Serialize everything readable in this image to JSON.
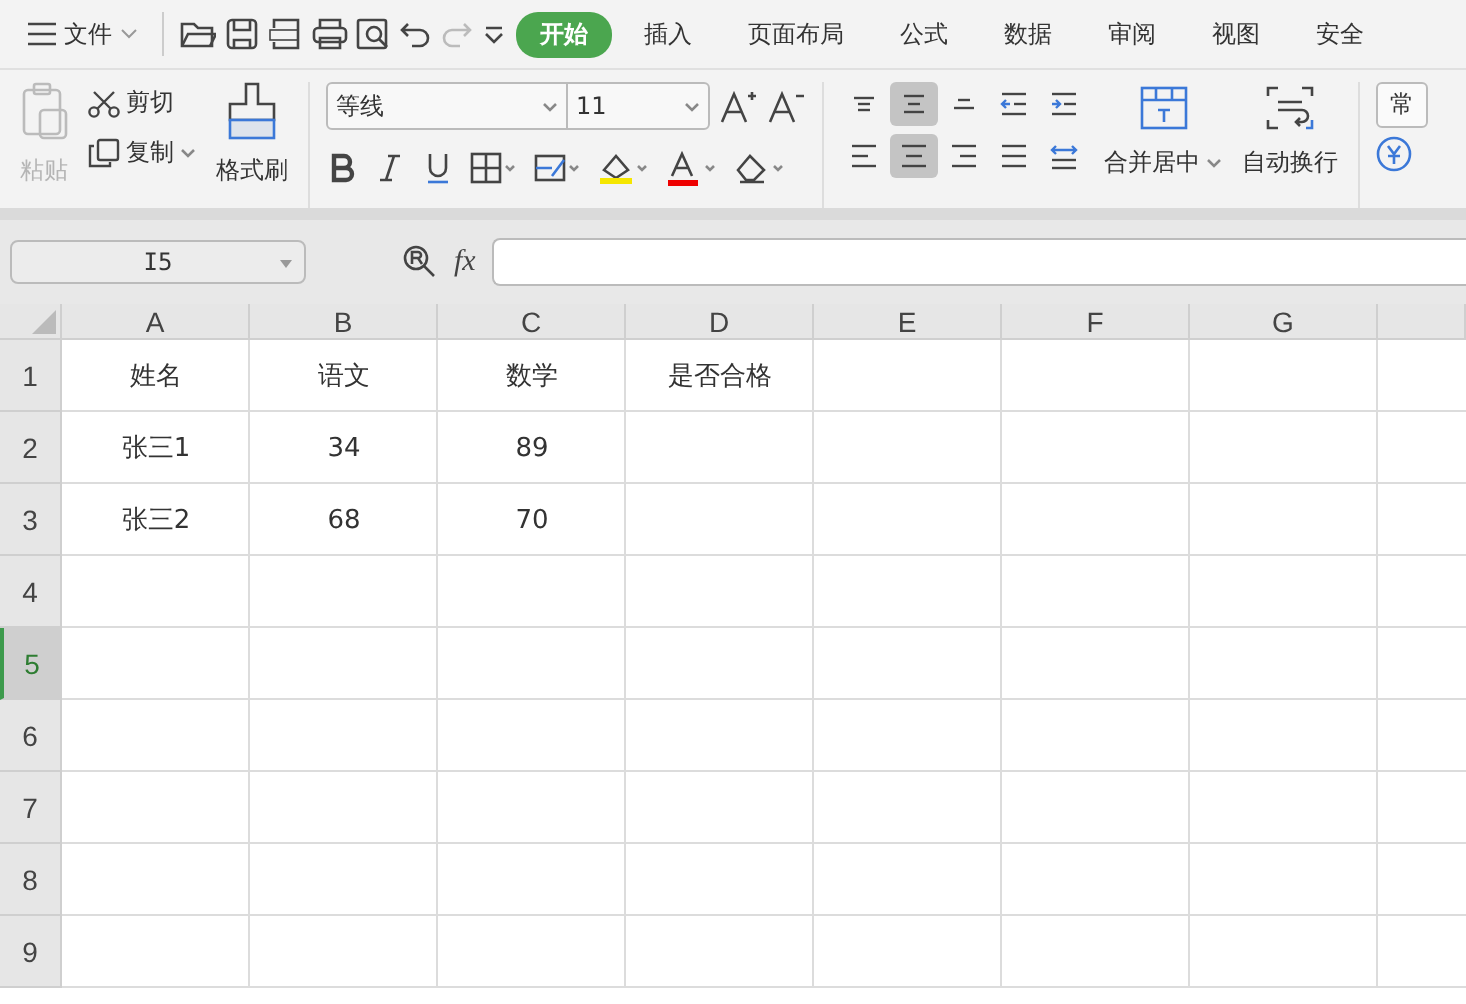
{
  "menu": {
    "label": "文件"
  },
  "tabs": [
    {
      "label": "开始",
      "selected": true
    },
    {
      "label": "插入",
      "selected": false
    },
    {
      "label": "页面布局",
      "selected": false
    },
    {
      "label": "公式",
      "selected": false
    },
    {
      "label": "数据",
      "selected": false
    },
    {
      "label": "审阅",
      "selected": false
    },
    {
      "label": "视图",
      "selected": false
    },
    {
      "label": "安全",
      "selected": false
    }
  ],
  "clipboard": {
    "paste": {
      "label": "粘贴",
      "disabled": true
    },
    "cut": "剪切",
    "copy": "复制",
    "format_painter": "格式刷"
  },
  "font": {
    "family": "等线",
    "size": "11"
  },
  "align_top": [
    {
      "kind": "top",
      "selected": false
    },
    {
      "kind": "middle",
      "selected": true
    },
    {
      "kind": "bottom",
      "selected": false
    },
    {
      "kind": "outdent",
      "selected": false
    },
    {
      "kind": "indent",
      "selected": false
    }
  ],
  "align_bottom": [
    {
      "kind": "left",
      "selected": false
    },
    {
      "kind": "center",
      "selected": true
    },
    {
      "kind": "right",
      "selected": false
    },
    {
      "kind": "justify",
      "selected": false
    },
    {
      "kind": "distribute",
      "selected": false
    }
  ],
  "merge": "合并居中",
  "wrap": "自动换行",
  "number_format": "常",
  "name_box": "I5",
  "function_label": "fx",
  "columns": [
    "A",
    "B",
    "C",
    "D",
    "E",
    "F",
    "G"
  ],
  "rows": [
    {
      "header": "1",
      "selected": false,
      "cells": [
        "姓名",
        "语文",
        "数学",
        "是否合格"
      ]
    },
    {
      "header": "2",
      "selected": false,
      "cells": [
        "张三1",
        "34",
        "89"
      ]
    },
    {
      "header": "3",
      "selected": false,
      "cells": [
        "张三2",
        "68",
        "70"
      ]
    },
    {
      "header": "4",
      "selected": false,
      "cells": []
    },
    {
      "header": "5",
      "selected": true,
      "cells": []
    },
    {
      "header": "6",
      "selected": false,
      "cells": []
    },
    {
      "header": "7",
      "selected": false,
      "cells": []
    },
    {
      "header": "8",
      "selected": false,
      "cells": []
    },
    {
      "header": "9",
      "selected": false,
      "cells": []
    }
  ]
}
